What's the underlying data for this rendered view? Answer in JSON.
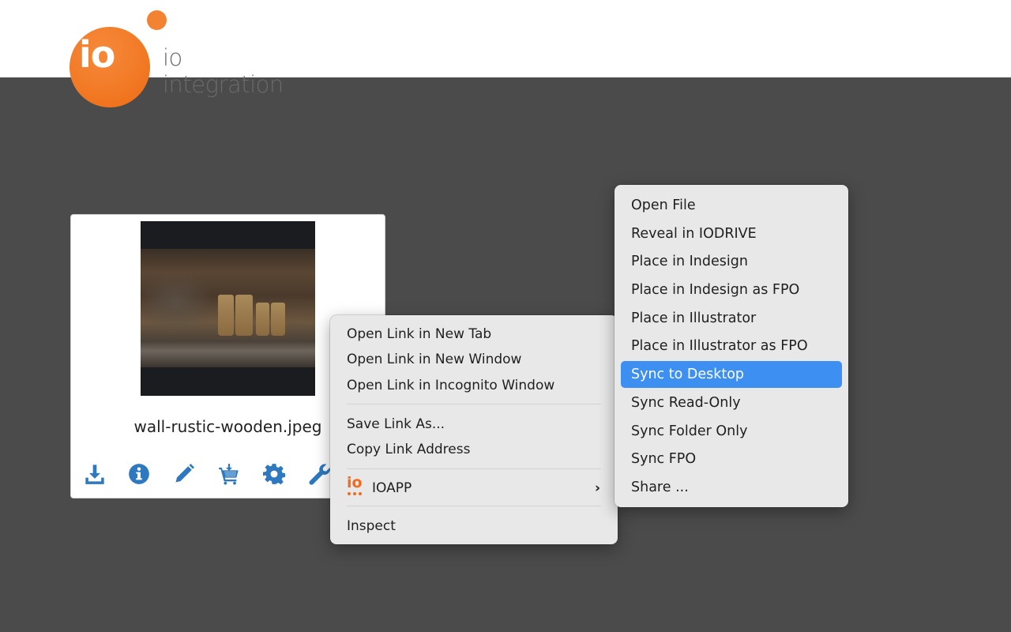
{
  "header": {
    "logo_mark": "io",
    "brand_name": "io integration",
    "brand_color": "#f27a26"
  },
  "asset_card": {
    "filename": "wall-rustic-wooden.jpeg",
    "thumbnail_alt": "Rustic wooden wall with boots",
    "actions": [
      {
        "name": "download",
        "icon": "download-icon"
      },
      {
        "name": "info",
        "icon": "info-icon"
      },
      {
        "name": "edit",
        "icon": "pencil-icon"
      },
      {
        "name": "add-to-cart",
        "icon": "cart-download-icon"
      },
      {
        "name": "settings",
        "icon": "gear-icon"
      },
      {
        "name": "tools",
        "icon": "wrench-icon"
      }
    ],
    "icon_color": "#2d78bf"
  },
  "context_menu": {
    "items": [
      {
        "label": "Open Link in New Tab"
      },
      {
        "label": "Open Link in New Window"
      },
      {
        "label": "Open Link in Incognito Window"
      },
      {
        "label": "Save Link As..."
      },
      {
        "label": "Copy Link Address"
      },
      {
        "label": "IOAPP",
        "icon": "ioapp-icon",
        "has_submenu": true
      },
      {
        "label": "Inspect"
      }
    ],
    "submenu_chevron": "›"
  },
  "submenu": {
    "items": [
      {
        "label": "Open File"
      },
      {
        "label": "Reveal in IODRIVE"
      },
      {
        "label": "Place in Indesign"
      },
      {
        "label": "Place in Indesign as FPO"
      },
      {
        "label": "Place in Illustrator"
      },
      {
        "label": "Place in Illustrator as FPO"
      },
      {
        "label": "Sync to Desktop",
        "highlighted": true
      },
      {
        "label": "Sync Read-Only"
      },
      {
        "label": "Sync Folder Only"
      },
      {
        "label": "Sync FPO"
      },
      {
        "label": "Share ..."
      }
    ],
    "highlight_color": "#3d8ff2"
  }
}
